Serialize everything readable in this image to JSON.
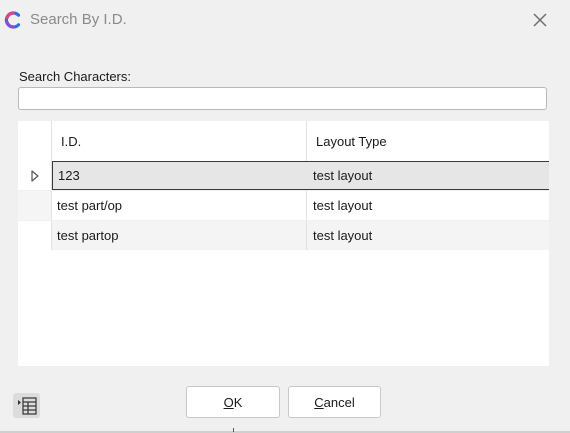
{
  "window": {
    "title": "Search By I.D."
  },
  "search": {
    "label": "Search Characters:",
    "value": "",
    "placeholder": ""
  },
  "grid": {
    "columns": [
      "I.D.",
      "Layout Type"
    ],
    "rows": [
      {
        "id": "123",
        "layout": "test layout",
        "selected": true
      },
      {
        "id": "test part/op",
        "layout": "test layout",
        "selected": false
      },
      {
        "id": "test partop",
        "layout": "test layout",
        "selected": false
      }
    ]
  },
  "buttons": {
    "ok_mnemonic": "O",
    "ok_rest": "K",
    "cancel_mnemonic": "C",
    "cancel_rest": "ancel"
  },
  "icons": {
    "app": "app-logo-icon",
    "close": "close-icon",
    "row_pointer": "row-pointer-icon",
    "layout": "grid-layout-icon"
  },
  "colors": {
    "logo_blue": "#2f6fd6",
    "logo_pink": "#e0448a",
    "logo_purple": "#8a4fd0",
    "selected_row": "#e6e6e6"
  }
}
